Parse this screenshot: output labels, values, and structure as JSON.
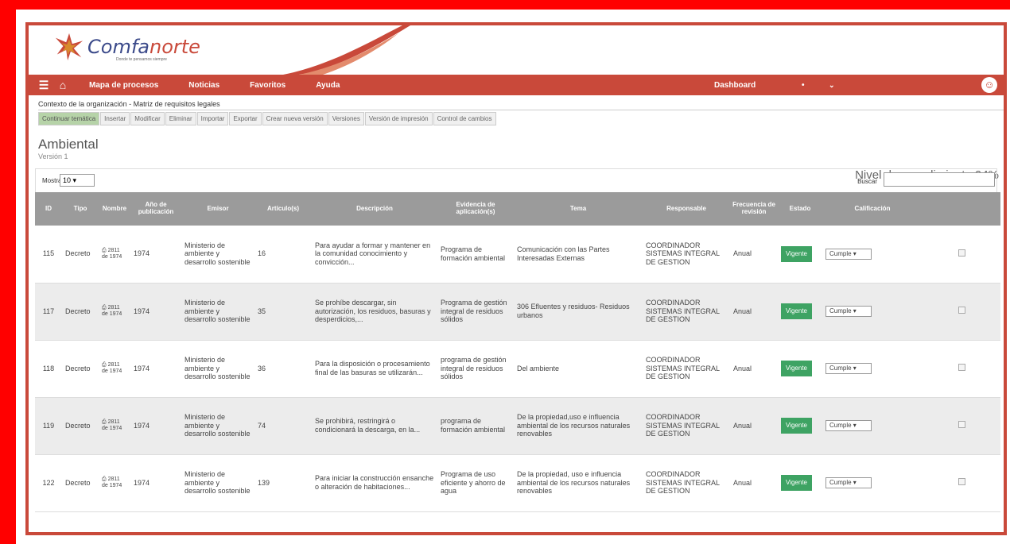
{
  "brand": {
    "name_part1": "Comfa",
    "name_part2": "norte",
    "tagline": "Donde te pensamos siempre",
    "brand_color": "#c9493a",
    "secondary_color": "#3b4a8a"
  },
  "nav": {
    "menu_icon": "hamburger-icon",
    "home_icon": "home-icon",
    "items": [
      "Mapa de procesos",
      "Noticias",
      "Favoritos",
      "Ayuda"
    ],
    "dashboard": "Dashboard",
    "dot": "•",
    "user_icon": "user-icon"
  },
  "breadcrumb": "Contexto de la organización - Matriz de requisitos legales",
  "toolbar": [
    "Continuar temática",
    "Insertar",
    "Modificar",
    "Eliminar",
    "Importar",
    "Exportar",
    "Crear nueva versión",
    "Versiones",
    "Versión de impresión",
    "Control de cambios"
  ],
  "section": {
    "title": "Ambiental",
    "version": "Versión 1",
    "compliance": "Nivel de cumplimiento 94%"
  },
  "controls": {
    "show_label": "Mostrar",
    "show_value": "10",
    "search_label": "Buscar"
  },
  "table": {
    "headers": [
      "ID",
      "Tipo",
      "Nombre",
      "Año de publicación",
      "Emisor",
      "Artículo(s)",
      "Descripción",
      "Evidencia de aplicación(s)",
      "Tema",
      "Responsable",
      "Frecuencia de revisión",
      "Estado",
      "Calificación",
      ""
    ],
    "rows": [
      {
        "id": "115",
        "tipo": "Decreto",
        "nombre": "2811 de 1974",
        "anio": "1974",
        "emisor": "Ministerio de ambiente y desarrollo sostenible",
        "articulo": "16",
        "descripcion": "Para ayudar a formar y mantener en la comunidad conocimiento y convicción...",
        "evidencia": "Programa de formación ambiental",
        "tema": "Comunicación con las Partes Interesadas Externas",
        "responsable": "COORDINADOR SISTEMAS INTEGRAL DE GESTION",
        "frecuencia": "Anual",
        "estado": "Vigente",
        "calificacion": "Cumple"
      },
      {
        "id": "117",
        "tipo": "Decreto",
        "nombre": "2811 de 1974",
        "anio": "1974",
        "emisor": "Ministerio de ambiente y desarrollo sostenible",
        "articulo": "35",
        "descripcion": "Se prohíbe descargar, sin autorización, los residuos, basuras y desperdicios,...",
        "evidencia": "Programa de gestión integral de residuos sólidos",
        "tema": "306 Efluentes y residuos- Residuos urbanos",
        "responsable": "COORDINADOR SISTEMAS INTEGRAL DE GESTION",
        "frecuencia": "Anual",
        "estado": "Vigente",
        "calificacion": "Cumple"
      },
      {
        "id": "118",
        "tipo": "Decreto",
        "nombre": "2811 de 1974",
        "anio": "1974",
        "emisor": "Ministerio de ambiente y desarrollo sostenible",
        "articulo": "36",
        "descripcion": "Para la disposición o procesamiento final de las basuras se utilizarán...",
        "evidencia": "programa de gestión integral de residuos sólidos",
        "tema": "Del ambiente",
        "responsable": "COORDINADOR SISTEMAS INTEGRAL DE GESTION",
        "frecuencia": "Anual",
        "estado": "Vigente",
        "calificacion": "Cumple"
      },
      {
        "id": "119",
        "tipo": "Decreto",
        "nombre": "2811 de 1974",
        "anio": "1974",
        "emisor": "Ministerio de ambiente y desarrollo sostenible",
        "articulo": "74",
        "descripcion": "Se prohibirá, restringirá o condicionará la descarga, en la...",
        "evidencia": "programa de formación ambiental",
        "tema": "De la propiedad,uso e influencia ambiental de los recursos naturales renovables",
        "responsable": "COORDINADOR SISTEMAS INTEGRAL DE GESTION",
        "frecuencia": "Anual",
        "estado": "Vigente",
        "calificacion": "Cumple"
      },
      {
        "id": "122",
        "tipo": "Decreto",
        "nombre": "2811 de 1974",
        "anio": "1974",
        "emisor": "Ministerio de ambiente y desarrollo sostenible",
        "articulo": "139",
        "descripcion": "Para iniciar la construcción ensanche o alteración de habitaciones...",
        "evidencia": "Programa de uso eficiente y ahorro de agua",
        "tema": "De la propiedad, uso e influencia ambiental de los recursos naturales renovables",
        "responsable": "COORDINADOR SISTEMAS INTEGRAL DE GESTION",
        "frecuencia": "Anual",
        "estado": "Vigente",
        "calificacion": "Cumple"
      }
    ]
  }
}
